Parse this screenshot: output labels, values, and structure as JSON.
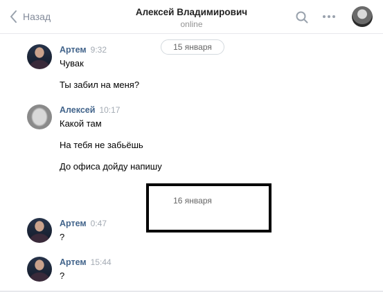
{
  "header": {
    "back_label": "Назад",
    "title": "Алексей Владимирович",
    "status": "online"
  },
  "dates": {
    "first": "15 января",
    "second": "16 января"
  },
  "messages": [
    {
      "author": "Артем",
      "time": "9:32",
      "lines": [
        "Чувак",
        "Ты забил на меня?"
      ]
    },
    {
      "author": "Алексей",
      "time": "10:17",
      "lines": [
        "Какой там",
        "На тебя не забьёшь",
        "До офиса дойду напишу"
      ]
    },
    {
      "author": "Артем",
      "time": "0:47",
      "lines": [
        "?"
      ]
    },
    {
      "author": "Артем",
      "time": "15:44",
      "lines": [
        "?"
      ]
    }
  ],
  "icons": {
    "back": "chevron-left-icon",
    "search": "search-icon",
    "more": "more-horizontal-icon"
  },
  "colors": {
    "author": "#42648b",
    "secondary_text": "#828a99",
    "divider": "#e7e8ec"
  }
}
